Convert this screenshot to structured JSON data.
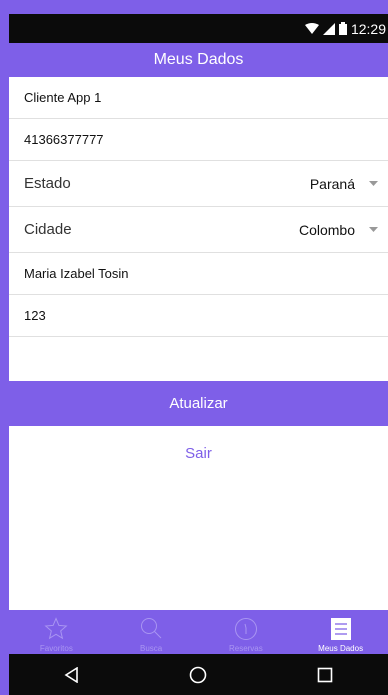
{
  "status_bar": {
    "time": "12:29"
  },
  "header": {
    "title": "Meus Dados"
  },
  "form": {
    "name": "Cliente App 1",
    "phone": "41366377777",
    "estado": {
      "label": "Estado",
      "value": "Paraná"
    },
    "cidade": {
      "label": "Cidade",
      "value": "Colombo"
    },
    "contact": "Maria Izabel Tosin",
    "number": "123",
    "extra": ""
  },
  "actions": {
    "update_label": "Atualizar",
    "logout_label": "Sair"
  },
  "tabs": [
    {
      "label": "Favoritos",
      "icon": "star-icon",
      "active": false
    },
    {
      "label": "Busca",
      "icon": "search-icon",
      "active": false
    },
    {
      "label": "Reservas",
      "icon": "clock-icon",
      "active": false
    },
    {
      "label": "Meus Dados",
      "icon": "list-icon",
      "active": true
    }
  ],
  "colors": {
    "accent": "#7e5fe8",
    "tab_inactive": "#a995f2",
    "system_bar": "#0b0b0b"
  }
}
